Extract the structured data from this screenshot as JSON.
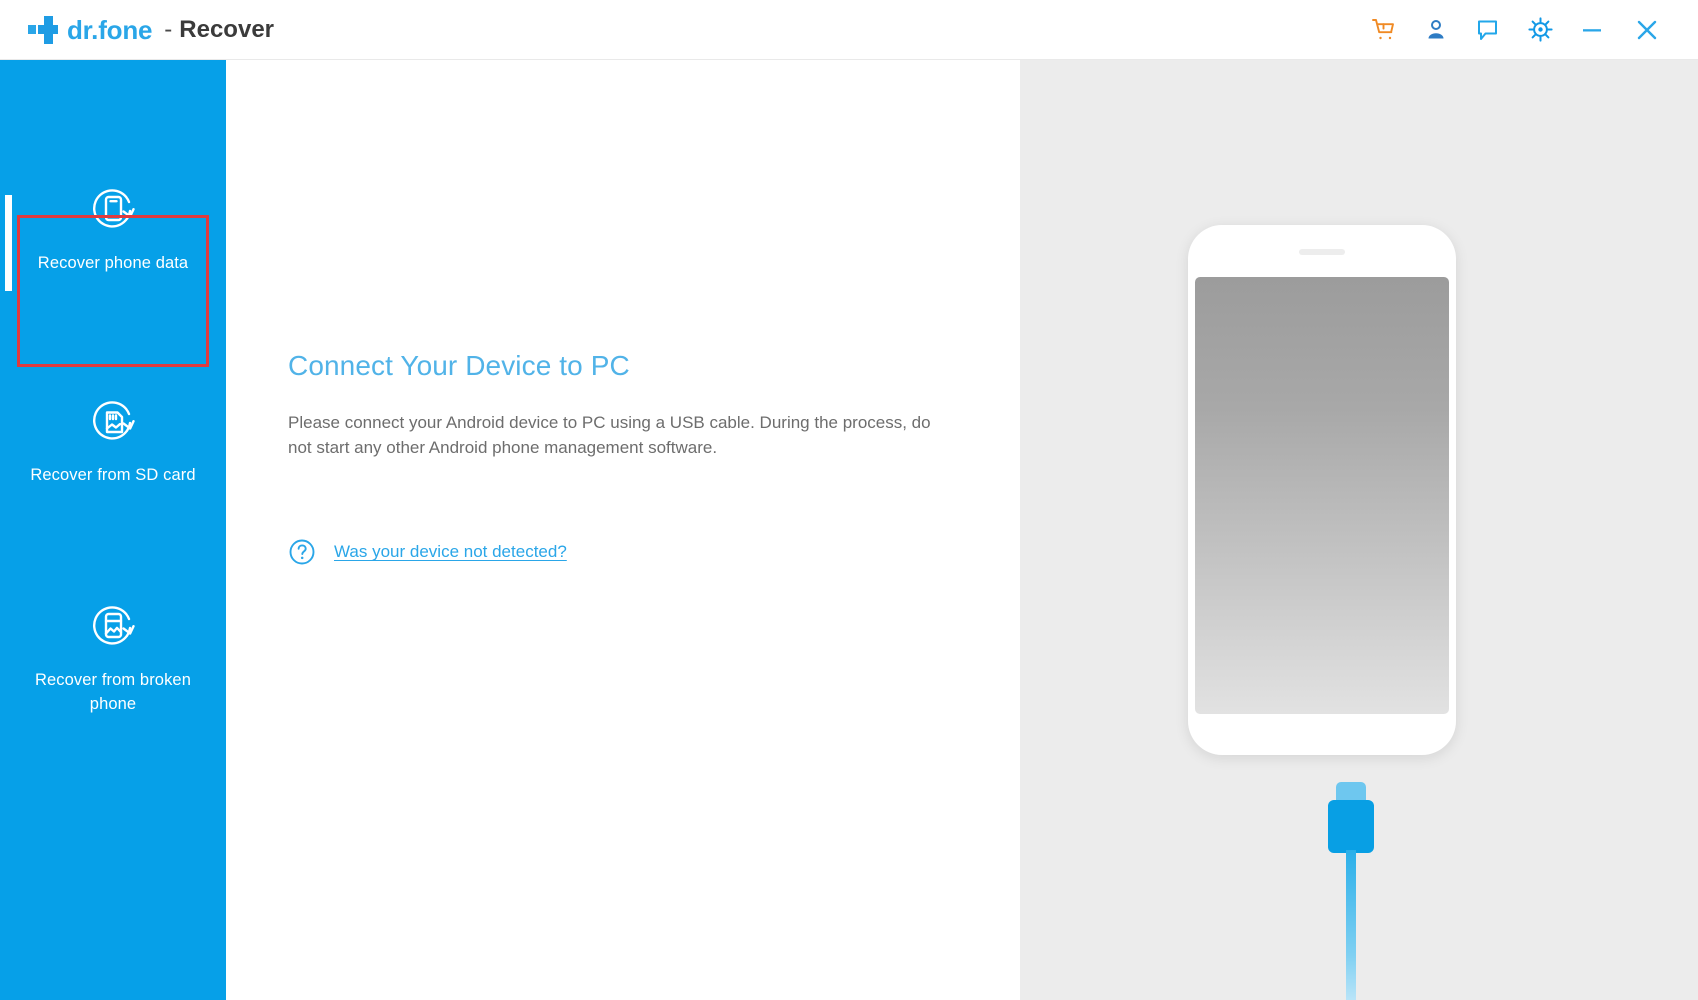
{
  "window": {
    "brand_name": "dr.fone",
    "separator": "-",
    "module": "Recover",
    "actions": [
      {
        "name": "cart-icon",
        "title": "Shop"
      },
      {
        "name": "account-icon",
        "title": "Account"
      },
      {
        "name": "feedback-icon",
        "title": "Feedback"
      },
      {
        "name": "settings-gear-icon",
        "title": "Settings"
      },
      {
        "name": "minimize-icon",
        "title": "Minimize"
      },
      {
        "name": "close-icon",
        "title": "Close"
      }
    ]
  },
  "sidebar": {
    "background": "#06a0e8",
    "items": [
      {
        "label": "Recover phone data",
        "icon": "recover-phone-data-icon",
        "selected": true
      },
      {
        "label": "Recover from SD card",
        "icon": "recover-sd-card-icon",
        "selected": false
      },
      {
        "label": "Recover from broken phone",
        "icon": "recover-broken-phone-icon",
        "selected": false
      }
    ]
  },
  "selection": {
    "color": "#e03a3e",
    "target": "Recover phone data"
  },
  "main": {
    "title": "Connect Your Device to PC",
    "title_color": "#51b3e8",
    "description": "Please connect your Android device to PC using a USB cable. During the process, do not start any other Android phone management software.",
    "help_link": "Was your device not detected?",
    "help_icon": "question-circle-icon",
    "link_color": "#2aa6e8"
  },
  "illustration": {
    "background": "#ececec",
    "device": "android-phone",
    "cable": "usb-cable",
    "cable_color": "#089fe4"
  }
}
